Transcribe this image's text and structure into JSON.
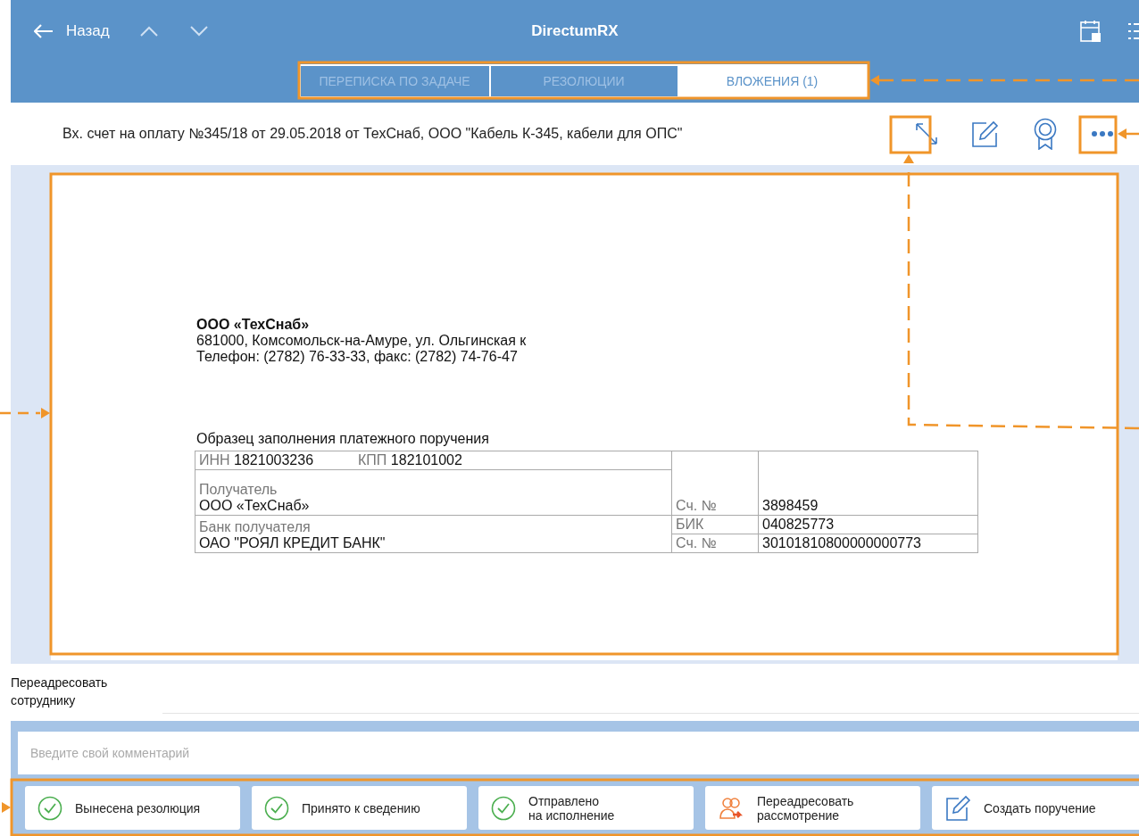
{
  "header": {
    "back_label": "Назад",
    "title": "DirectumRX"
  },
  "tabs": [
    {
      "label": "ПЕРЕПИСКА ПО ЗАДАЧЕ",
      "selected": false
    },
    {
      "label": "РЕЗОЛЮЦИИ",
      "selected": false
    },
    {
      "label": "ВЛОЖЕНИЯ (1)",
      "selected": true
    }
  ],
  "document_title": "Вх. счет на оплату №345/18 от 29.05.2018 от ТехСнаб, ООО \"Кабель К-345, кабели для ОПС\"",
  "document": {
    "company": "ООО «ТехСнаб»",
    "address": "681000, Комсомольск-на-Амуре, ул. Ольгинская к",
    "phone": "Телефон: (2782) 76-33-33, факс: (2782) 74-76-47",
    "form_title": "Образец заполнения платежного поручения",
    "table": {
      "inn_label": "ИНН",
      "inn": "1821003236",
      "kpp_label": "КПП",
      "kpp": "182101002",
      "recipient_label": "Получатель",
      "recipient": "ООО «ТехСнаб»",
      "account_label": "Сч. №",
      "account": "3898459",
      "bank_label": "Банк получателя",
      "bank": "ОАО \"РОЯЛ КРЕДИТ БАНК\"",
      "bik_label": "БИК",
      "bik": "040825773",
      "corr_label": "Сч. №",
      "corr": "30101810800000000773"
    }
  },
  "forward_label": "Переадресовать сотруднику",
  "comment": {
    "placeholder": "Введите свой комментарий"
  },
  "actions": [
    {
      "kind": "check",
      "label": "Вынесена резолюция"
    },
    {
      "kind": "check",
      "label": "Принято к сведению"
    },
    {
      "kind": "check",
      "label": "Отправлено\nна исполнение"
    },
    {
      "kind": "forward",
      "label": "Переадресовать\nрассмотрение"
    },
    {
      "kind": "edit",
      "label": "Создать поручение"
    }
  ]
}
